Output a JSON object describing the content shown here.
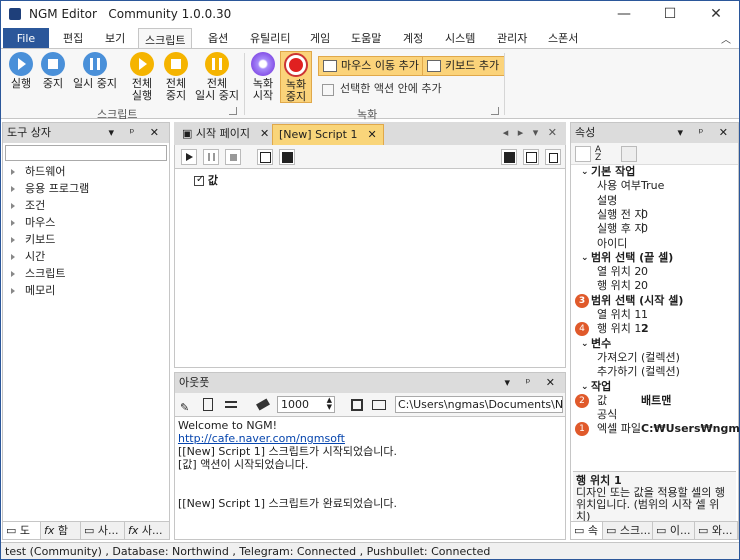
{
  "window": {
    "title": "NGM Editor   Community 1.0.0.30",
    "min": "—",
    "max": "☐",
    "close": "✕"
  },
  "menu": {
    "file": "File",
    "tabs": [
      "편집",
      "보기",
      "스크립트",
      "옵션",
      "유틸리티",
      "게임",
      "도움말",
      "계정",
      "시스템",
      "관리자",
      "스폰서"
    ],
    "collapse": "︿"
  },
  "ribbon": {
    "script_group": {
      "label": "스크립트",
      "buttons": [
        {
          "line1": "실행",
          "line2": ""
        },
        {
          "line1": "중지",
          "line2": ""
        },
        {
          "line1": "일시 중지",
          "line2": ""
        },
        {
          "line1": "전체",
          "line2": "실행"
        },
        {
          "line1": "전체",
          "line2": "중지"
        },
        {
          "line1": "전체",
          "line2": "일시 중지"
        }
      ]
    },
    "record_group": {
      "label": "녹화",
      "start": {
        "line1": "녹화",
        "line2": "시작"
      },
      "stop": {
        "line1": "녹화",
        "line2": "중지"
      },
      "add_mouse": "마우스 이동 추가",
      "add_keyboard": "키보드 추가",
      "add_action": "선택한 액션 안에 추가"
    }
  },
  "toolbox": {
    "title": "도구 상자",
    "buttons": "▾ ᵖ ✕",
    "items": [
      "하드웨어",
      "응용 프로그램",
      "조건",
      "마우스",
      "키보드",
      "시간",
      "스크립트",
      "메모리"
    ],
    "bottom_tabs": [
      "도",
      "함",
      "사...",
      "사..."
    ]
  },
  "documents": {
    "tabs": [
      {
        "label": "시작 페이지",
        "close": "✕"
      },
      {
        "label": "[New] Script 1",
        "close": "✕"
      }
    ],
    "nav": "◂ ▸ ▾ ✕",
    "action": "값"
  },
  "output": {
    "title": "아웃풋",
    "buttons": "▾ ᵖ ✕",
    "count": "1000",
    "path": "C:\\Users\\ngmas\\Documents\\NGM5\\",
    "lines": [
      {
        "text": "Welcome to NGM!",
        "link": false
      },
      {
        "text": "http://cafe.naver.com/ngmsoft",
        "link": true
      },
      {
        "text": "[[New] Script 1] 스크립트가 시작되었습니다.",
        "link": false
      },
      {
        "text": "[값] 액션이 시작되었습니다.",
        "link": false
      },
      {
        "text": "",
        "link": false
      },
      {
        "text": "",
        "link": false
      },
      {
        "text": "[[New] Script 1] 스크립트가 완료되었습니다.",
        "link": false
      }
    ]
  },
  "properties": {
    "title": "속성",
    "buttons": "▾ ᵖ ✕",
    "rows": [
      {
        "type": "cat",
        "key": "기본 작업",
        "value": "",
        "badge": ""
      },
      {
        "type": "row",
        "key": "사용 여부",
        "value": "True",
        "badge": ""
      },
      {
        "type": "row",
        "key": "설명",
        "value": "",
        "badge": ""
      },
      {
        "type": "row",
        "key": "실행 전 지",
        "value": "0",
        "badge": ""
      },
      {
        "type": "row",
        "key": "실행 후 지",
        "value": "0",
        "badge": ""
      },
      {
        "type": "row",
        "key": "아이디",
        "value": "",
        "badge": ""
      },
      {
        "type": "cat",
        "key": "범위 선택 (끝 셀)",
        "value": "",
        "badge": ""
      },
      {
        "type": "row",
        "key": "열 위치 2",
        "value": "0",
        "badge": ""
      },
      {
        "type": "row",
        "key": "행 위치 2",
        "value": "0",
        "badge": ""
      },
      {
        "type": "cat",
        "key": "범위 선택 (시작 셀)",
        "value": "",
        "badge": "3"
      },
      {
        "type": "row",
        "key": "열 위치 1",
        "value": "1",
        "badge": ""
      },
      {
        "type": "row",
        "key": "행 위치 1",
        "value": "2",
        "badge": "4"
      },
      {
        "type": "cat",
        "key": "변수",
        "value": "",
        "badge": ""
      },
      {
        "type": "row",
        "key": "가져오기",
        "value": "(컬렉션)",
        "badge": ""
      },
      {
        "type": "row",
        "key": "추가하기",
        "value": "(컬렉션)",
        "badge": ""
      },
      {
        "type": "cat",
        "key": "작업",
        "value": "",
        "badge": ""
      },
      {
        "type": "row",
        "key": "값",
        "value": "배트맨",
        "badge": "2"
      },
      {
        "type": "row",
        "key": "공식",
        "value": "",
        "badge": ""
      },
      {
        "type": "row",
        "key": "엑셀 파일",
        "value": "C:₩Users₩ngma",
        "badge": "1"
      }
    ],
    "desc_title": "행 위치 1",
    "desc_text": "디자인 또는 값을 적용할 셀의 행 위치입니다. (범위의 시작 셀 위치)",
    "bottom_tabs": [
      "속",
      "스크...",
      "이...",
      "와..."
    ]
  },
  "status": "test (Community) , Database: Northwind , Telegram: Connected , Pushbullet: Connected"
}
